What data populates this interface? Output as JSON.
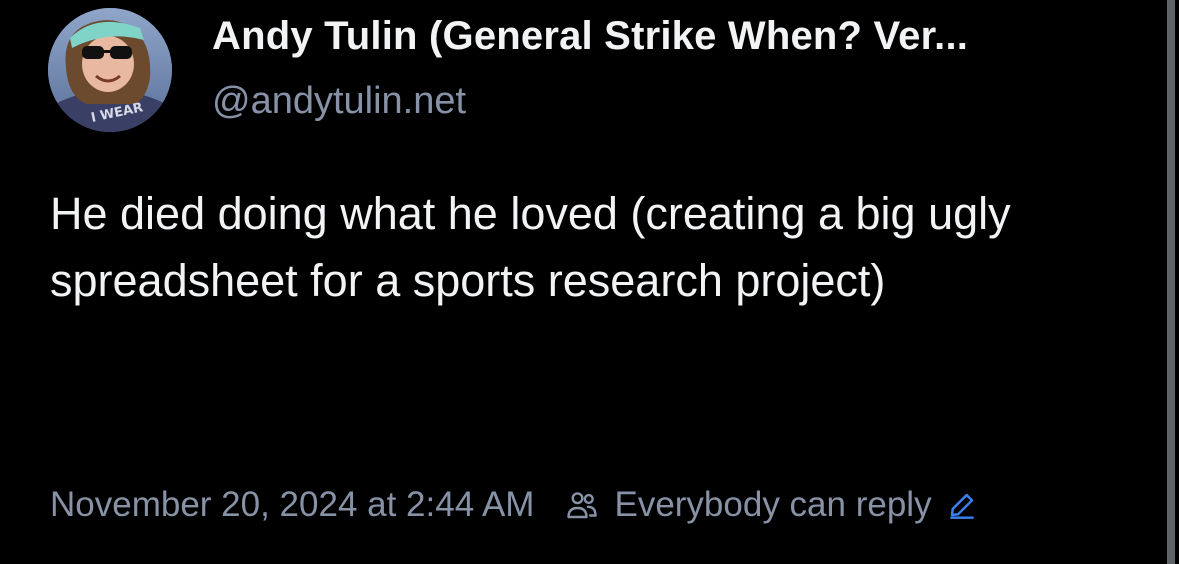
{
  "post": {
    "author_name": "Andy Tulin (General Strike When? Ver...",
    "author_handle": "@andytulin.net",
    "avatar_shirt_text": "I WEAR",
    "text": "He died doing what he loved (creating a big ugly spreadsheet for a sports research project)",
    "timestamp": "November 20, 2024 at 2:44 AM",
    "reply_setting": "Everybody can reply"
  },
  "icons": {
    "audience": "people-icon",
    "edit": "pencil-icon"
  },
  "colors": {
    "background": "#000000",
    "primary_text": "#f1f3f5",
    "secondary_text": "#8792a6",
    "link": "#3b82f6"
  }
}
